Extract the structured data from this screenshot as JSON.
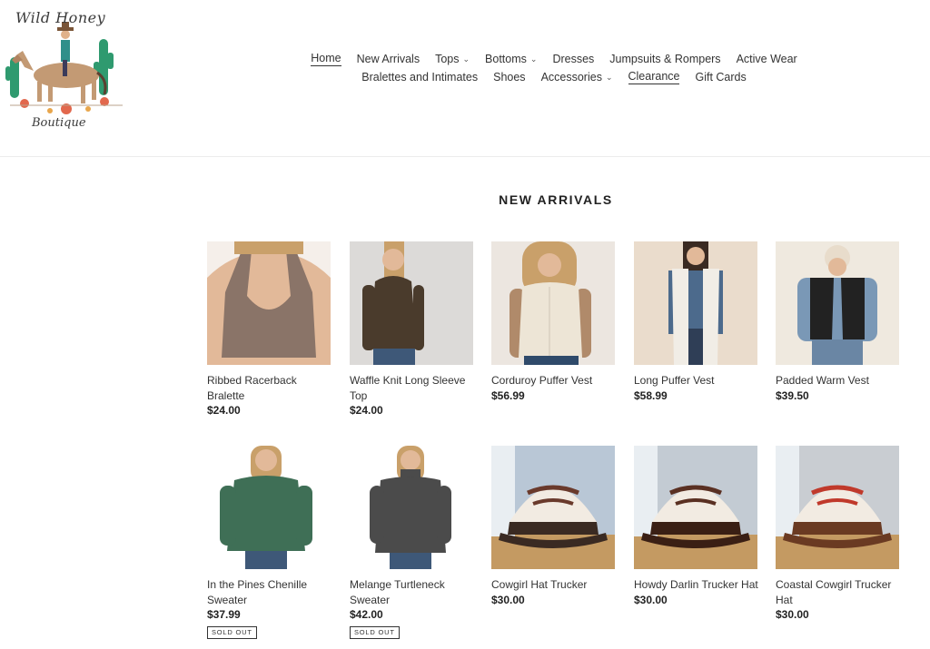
{
  "store": {
    "logo_top": "Wild Honey",
    "logo_bottom": "Boutique"
  },
  "nav": {
    "row1": [
      {
        "label": "Home",
        "dropdown": false,
        "active": true
      },
      {
        "label": "New Arrivals",
        "dropdown": false,
        "active": false
      },
      {
        "label": "Tops",
        "dropdown": true,
        "active": false
      },
      {
        "label": "Bottoms",
        "dropdown": true,
        "active": false
      },
      {
        "label": "Dresses",
        "dropdown": false,
        "active": false
      },
      {
        "label": "Jumpsuits & Rompers",
        "dropdown": false,
        "active": false
      },
      {
        "label": "Active Wear",
        "dropdown": false,
        "active": false
      }
    ],
    "row2": [
      {
        "label": "Bralettes and Intimates",
        "dropdown": false,
        "active": false
      },
      {
        "label": "Shoes",
        "dropdown": false,
        "active": false
      },
      {
        "label": "Accessories",
        "dropdown": true,
        "active": false
      },
      {
        "label": "Clearance",
        "dropdown": false,
        "active": true
      },
      {
        "label": "Gift Cards",
        "dropdown": false,
        "active": false
      }
    ]
  },
  "section": {
    "title": "NEW ARRIVALS"
  },
  "products": [
    {
      "name": "Ribbed Racerback Bralette",
      "price": "$24.00",
      "sold_out": false,
      "image": "bralette",
      "color": "#8a7468",
      "bg": "#f5efea"
    },
    {
      "name": "Waffle Knit Long Sleeve Top",
      "price": "$24.00",
      "sold_out": false,
      "image": "longsleeve",
      "color": "#4a3b2c",
      "bg": "#dcdad8"
    },
    {
      "name": "Corduroy Puffer Vest",
      "price": "$56.99",
      "sold_out": false,
      "image": "vest-cream",
      "color": "#ede5d6",
      "bg": "#ece6e0"
    },
    {
      "name": "Long Puffer Vest",
      "price": "$58.99",
      "sold_out": false,
      "image": "vest-long",
      "color": "#f1ede6",
      "bg": "#eadccc"
    },
    {
      "name": "Padded Warm Vest",
      "price": "$39.50",
      "sold_out": false,
      "image": "vest-black",
      "color": "#222222",
      "bg": "#efe9df"
    },
    {
      "name": "In the Pines Chenille Sweater",
      "price": "$37.99",
      "sold_out": true,
      "image": "sweater-green",
      "color": "#3f6f56",
      "bg": "#ffffff"
    },
    {
      "name": "Melange Turtleneck Sweater",
      "price": "$42.00",
      "sold_out": true,
      "image": "sweater-gray",
      "color": "#4b4b4b",
      "bg": "#ffffff"
    },
    {
      "name": "Cowgirl Hat Trucker",
      "price": "$30.00",
      "sold_out": false,
      "image": "hat-cowgirl",
      "color": "#3a2a22",
      "bg": "#b9c7d6"
    },
    {
      "name": "Howdy Darlin Trucker Hat",
      "price": "$30.00",
      "sold_out": false,
      "image": "hat-howdy",
      "color": "#3a1f14",
      "bg": "#c3cbd3"
    },
    {
      "name": "Coastal Cowgirl Trucker Hat",
      "price": "$30.00",
      "sold_out": false,
      "image": "hat-coastal",
      "color": "#6a3a22",
      "bg": "#c9cdd2"
    }
  ],
  "labels": {
    "sold_out": "SOLD OUT"
  }
}
